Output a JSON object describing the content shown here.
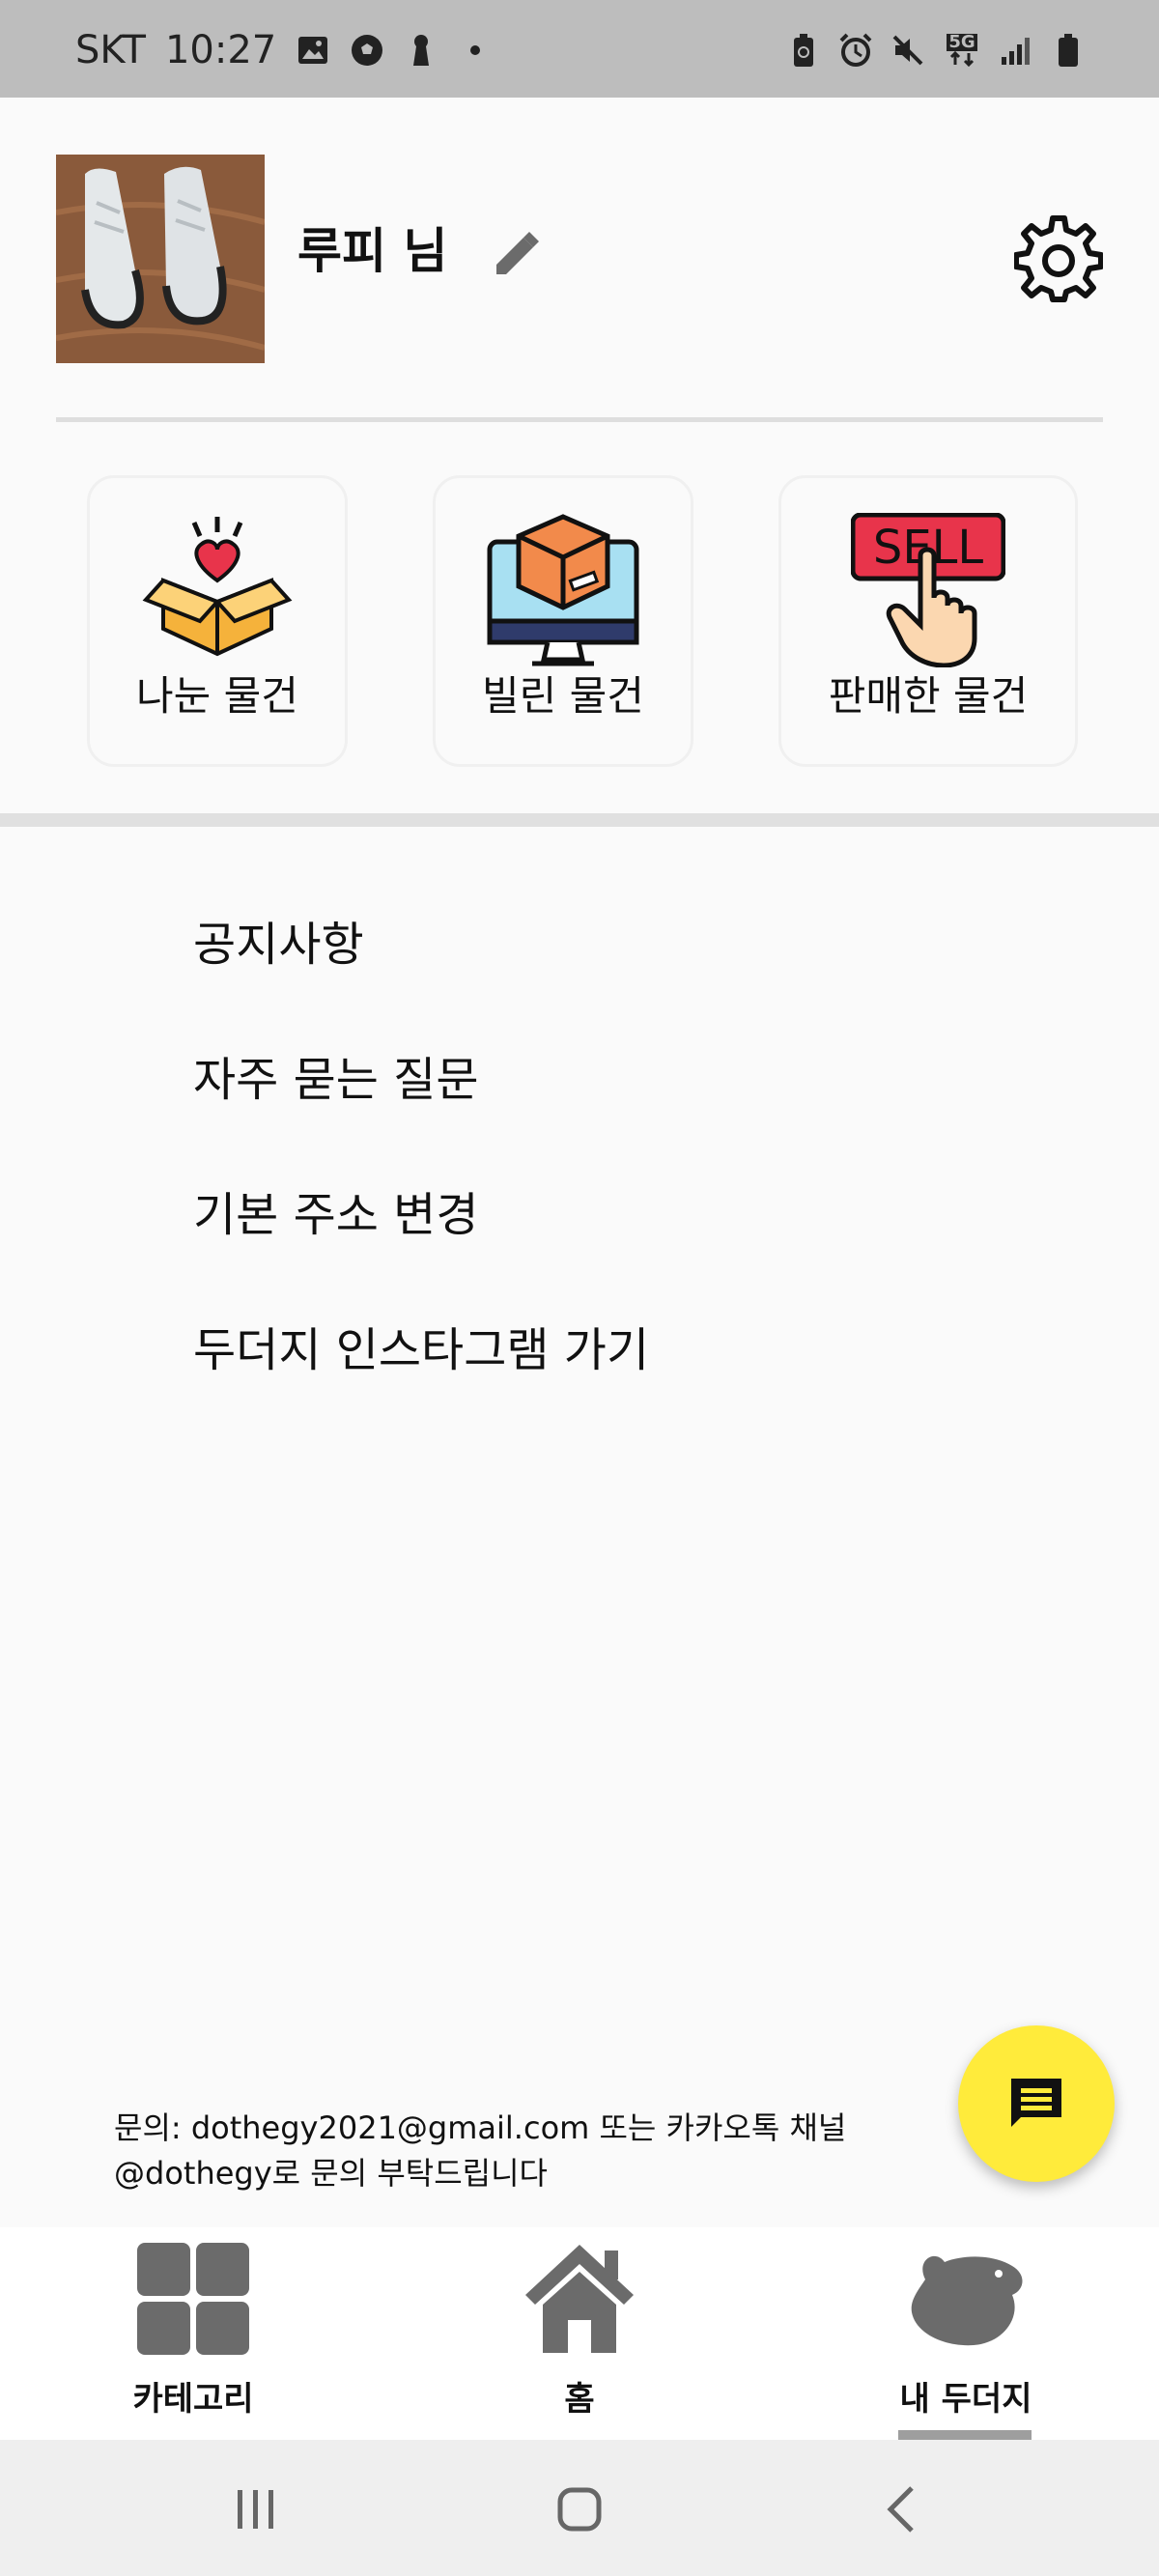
{
  "status_bar": {
    "carrier": "SKT",
    "time": "10:27",
    "network": "5G",
    "left_icons": [
      "gallery-icon",
      "soccer-ball-icon",
      "keyhole-icon",
      "dot-icon"
    ],
    "right_icons": [
      "battery-saver-icon",
      "alarm-icon",
      "mute-icon",
      "5g-icon",
      "signal-icon",
      "battery-icon"
    ]
  },
  "profile": {
    "name": "루피 님",
    "avatar_icon": "sneakers-photo",
    "edit_icon": "pencil-icon",
    "settings_icon": "gear-icon"
  },
  "tiles": [
    {
      "label": "나눈 물건",
      "icon": "heart-box-icon"
    },
    {
      "label": "빌린 물건",
      "icon": "monitor-box-icon"
    },
    {
      "label": "판매한 물건",
      "icon": "sell-sign-icon",
      "badge_text": "SELL"
    }
  ],
  "menu": [
    {
      "label": "공지사항"
    },
    {
      "label": "자주 묻는 질문"
    },
    {
      "label": "기본 주소 변경"
    },
    {
      "label": "두더지 인스타그램 가기"
    }
  ],
  "contact": {
    "line1": "문의: dothegy2021@gmail.com 또는 카카오톡 채널",
    "line2": "@dothegy로 문의 부탁드립니다"
  },
  "fab": {
    "icon": "chat-icon",
    "color": "#ffeb3b"
  },
  "bottom_nav": {
    "items": [
      {
        "label": "카테고리",
        "icon": "grid-icon"
      },
      {
        "label": "홈",
        "icon": "home-icon"
      },
      {
        "label": "내 두더지",
        "icon": "mole-icon",
        "active": true
      }
    ]
  },
  "system_nav": [
    "recent-apps-icon",
    "home-button-icon",
    "back-icon"
  ],
  "colors": {
    "accent": "#ffeb3b",
    "icon_gray": "#6b6b6b",
    "divider": "#e0e0e0",
    "sell_red": "#e8344b"
  }
}
